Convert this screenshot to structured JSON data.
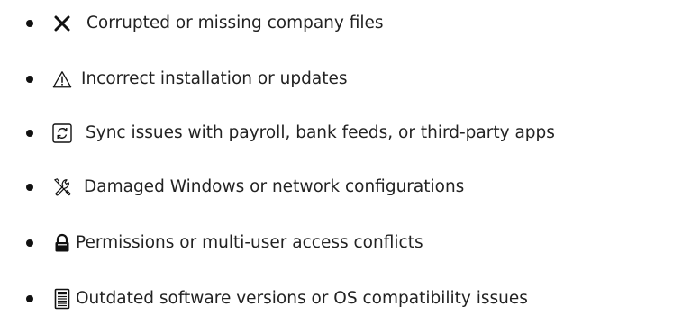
{
  "items": [
    {
      "icon": "cross-mark-icon",
      "label": "Corrupted or missing company files"
    },
    {
      "icon": "warning-icon",
      "label": "Incorrect installation or updates"
    },
    {
      "icon": "sync-icon",
      "label": "Sync issues with payroll, bank feeds, or third-party apps"
    },
    {
      "icon": "tools-icon",
      "label": "Damaged Windows or network configurations"
    },
    {
      "icon": "lock-icon",
      "label": "Permissions or multi-user access conflicts"
    },
    {
      "icon": "document-icon",
      "label": "Outdated software versions or OS compatibility issues"
    }
  ]
}
